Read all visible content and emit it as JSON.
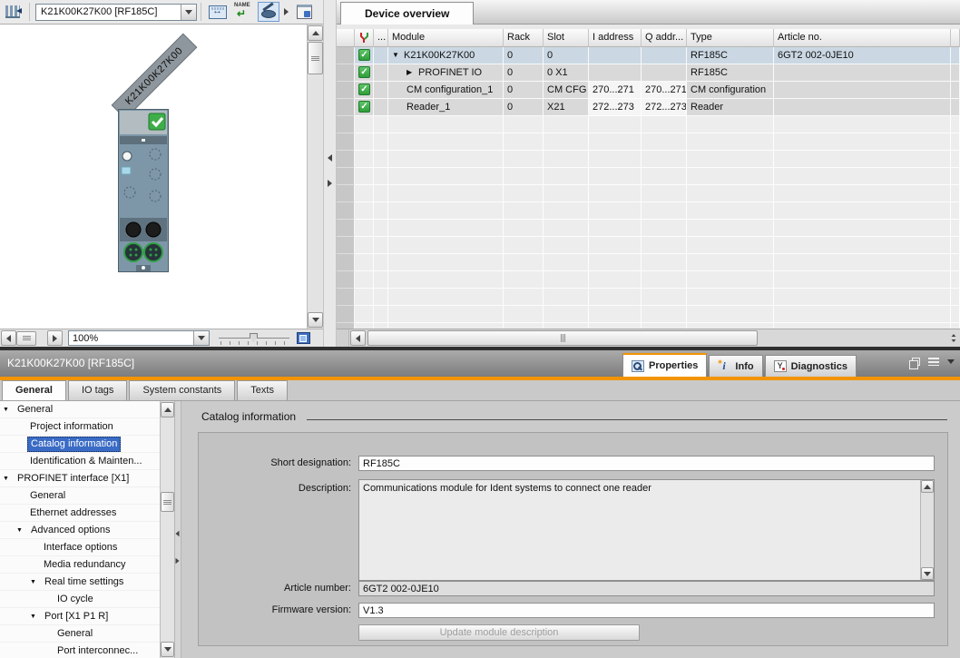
{
  "toolbar": {
    "device_selector_value": "K21K00K27K00 [RF185C]",
    "buttons": [
      {
        "icon": "pan-width-icon"
      },
      {
        "icon": "assign-device-name-icon"
      },
      {
        "icon": "show-labels-icon",
        "active": true,
        "dropdown": true
      },
      {
        "icon": "module-window-icon"
      }
    ]
  },
  "device_view": {
    "device_label": "K21K00K27K00",
    "zoom_value": "100%"
  },
  "overview": {
    "tab": "Device overview",
    "columns": {
      "dots": "...",
      "module": "Module",
      "rack": "Rack",
      "slot": "Slot",
      "i_address": "I address",
      "q_address": "Q addr...",
      "type": "Type",
      "article": "Article no."
    },
    "rows": [
      {
        "module": "K21K00K27K00",
        "expand": "down",
        "indent": 0,
        "rack": "0",
        "slot": "0",
        "i_address": "",
        "q_address": "",
        "type": "RF185C",
        "article": "6GT2 002-0JE10",
        "selected": true,
        "checked": true
      },
      {
        "module": "PROFINET IO",
        "expand": "right",
        "indent": 1,
        "rack": "0",
        "slot": "0 X1",
        "i_address": "",
        "q_address": "",
        "type": "RF185C",
        "article": "",
        "checked": true
      },
      {
        "module": "CM configuration_1",
        "rack": "0",
        "slot": "CM CFG",
        "i_address": "270...271",
        "q_address": "270...271",
        "type": "CM configuration",
        "article": "",
        "checked": true
      },
      {
        "module": "Reader_1",
        "rack": "0",
        "slot": "X21",
        "i_address": "272...273",
        "q_address": "272...273",
        "type": "Reader",
        "article": "",
        "checked": true
      }
    ]
  },
  "inspector": {
    "title": "K21K00K27K00 [RF185C]",
    "tabs": [
      {
        "label": "Properties",
        "icon": "properties-icon",
        "active": true
      },
      {
        "label": "Info",
        "icon": "info-icon"
      },
      {
        "label": "Diagnostics",
        "icon": "diagnostics-icon"
      }
    ],
    "subtabs": [
      {
        "label": "General",
        "active": true
      },
      {
        "label": "IO tags"
      },
      {
        "label": "System constants"
      },
      {
        "label": "Texts"
      }
    ],
    "tree": [
      {
        "label": "General",
        "depth": 0,
        "expand": "down"
      },
      {
        "label": "Project information",
        "depth": 1
      },
      {
        "label": "Catalog information",
        "depth": 1,
        "selected": true
      },
      {
        "label": "Identification & Mainten...",
        "depth": 1
      },
      {
        "label": "PROFINET interface [X1]",
        "depth": 0,
        "expand": "down"
      },
      {
        "label": "General",
        "depth": 1
      },
      {
        "label": "Ethernet addresses",
        "depth": 1
      },
      {
        "label": "Advanced options",
        "depth": 1,
        "expand": "down"
      },
      {
        "label": "Interface options",
        "depth": 2
      },
      {
        "label": "Media redundancy",
        "depth": 2
      },
      {
        "label": "Real time settings",
        "depth": 2,
        "expand": "down"
      },
      {
        "label": "IO cycle",
        "depth": 3
      },
      {
        "label": "Port [X1 P1 R]",
        "depth": 2,
        "expand": "down"
      },
      {
        "label": "General",
        "depth": 3
      },
      {
        "label": "Port interconnec...",
        "depth": 3
      }
    ],
    "section_title": "Catalog information",
    "fields": {
      "short_designation_label": "Short designation:",
      "short_designation": "RF185C",
      "description_label": "Description:",
      "description": "Communications module for Ident systems to connect one reader",
      "article_number_label": "Article number:",
      "article_number": "6GT2 002-0JE10",
      "firmware_label": "Firmware version:",
      "firmware": "V1.3",
      "update_button": "Update module description"
    }
  },
  "colors": {
    "accent_orange": "#f29400",
    "check_green": "#3fae49",
    "selection_blue": "#3a6bc5",
    "row_selected": "#cbd8e3"
  }
}
